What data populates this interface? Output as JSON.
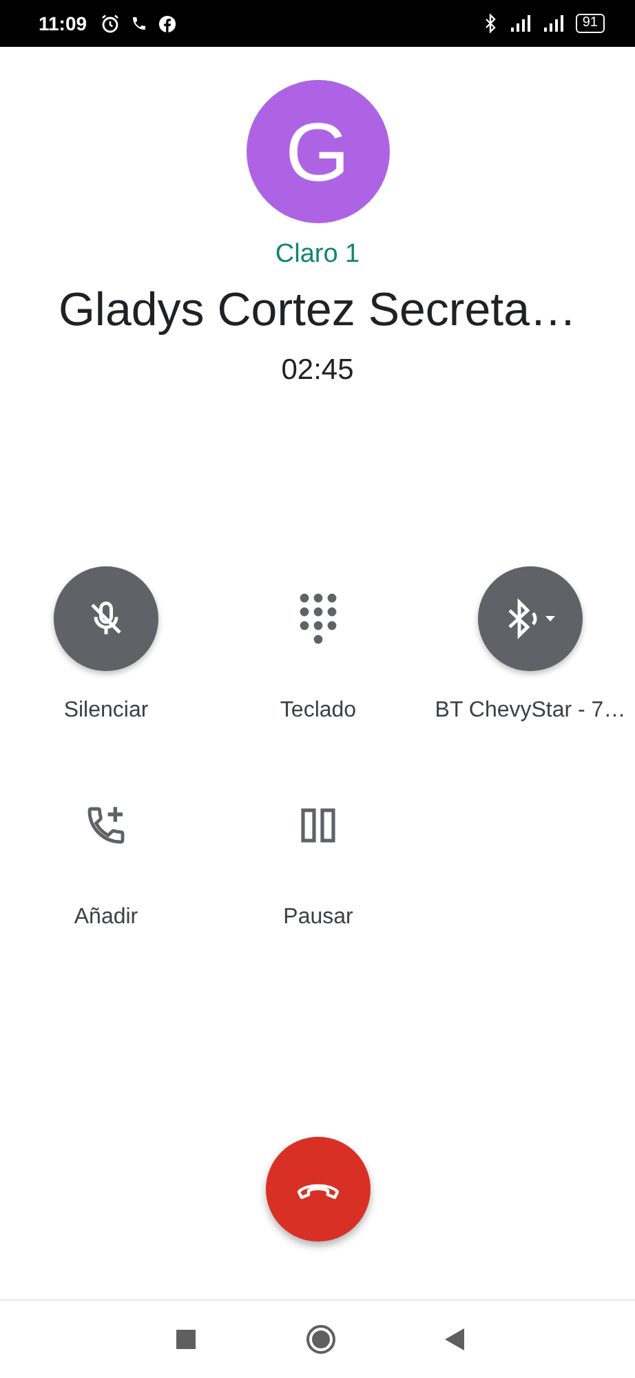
{
  "status_bar": {
    "time": "11:09",
    "battery": "91"
  },
  "caller": {
    "initial": "G",
    "account": "Claro 1",
    "name": "Gladys Cortez Secreta…",
    "duration": "02:45"
  },
  "controls": [
    {
      "kind": "mute",
      "label": "Silenciar",
      "on": true
    },
    {
      "kind": "keypad",
      "label": "Teclado",
      "on": false
    },
    {
      "kind": "audio",
      "label": "BT ChevyStar - 7…",
      "on": true
    },
    {
      "kind": "add",
      "label": "Añadir",
      "on": false
    },
    {
      "kind": "hold",
      "label": "Pausar",
      "on": false
    }
  ]
}
